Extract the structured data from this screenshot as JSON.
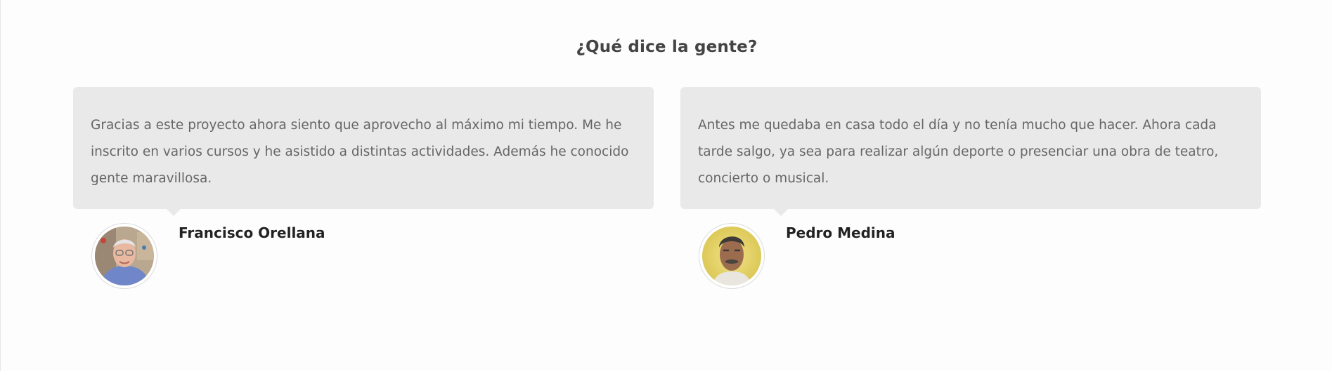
{
  "section": {
    "title": "¿Qué dice la gente?"
  },
  "testimonials": [
    {
      "quote": "Gracias a este proyecto ahora siento que aprovecho al máximo mi tiempo. Me he inscrito en varios cursos y he asistido a distintas actividades. Además he conocido gente maravillosa.",
      "name": "Francisco Orellana",
      "avatar_icon": "person-photo-icon"
    },
    {
      "quote": "Antes me quedaba en casa todo el día y no tenía mucho que hacer. Ahora cada tarde salgo, ya sea para realizar algún deporte o presenciar una obra de teatro, concierto o musical.",
      "name": "Pedro Medina",
      "avatar_icon": "person-photo-icon"
    }
  ],
  "colors": {
    "background": "#fdfdfd",
    "quote_box": "#e9e9e9",
    "title": "#444444",
    "quote_text": "#666666",
    "name": "#222222"
  }
}
